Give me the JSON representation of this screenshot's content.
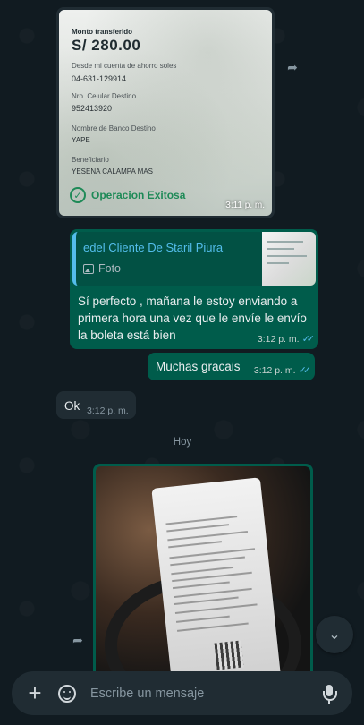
{
  "receipt": {
    "title": "Monto transferido",
    "amount": "S/ 280.00",
    "from_label": "Desde mi cuenta de ahorro soles",
    "from_value": "04-631-129914",
    "phone_label": "Nro. Celular Destino",
    "phone_value": "952413920",
    "bank_label": "Nombre de Banco Destino",
    "bank_value": "YAPE",
    "beneficiary_label": "Beneficiario",
    "beneficiary_value": "YESENA CALAMPA MAS",
    "status": "Operacion Exitosa",
    "time": "3:11 p. m."
  },
  "messages": {
    "reply": {
      "quoted_author": "edel Cliente De Staril Piura",
      "quoted_type": "Foto",
      "text": "Sí perfecto , mañana le estoy enviando a primera hora  una vez que le envíe  le envío la boleta está bien",
      "time": "3:12 p. m."
    },
    "gracias": {
      "text": "Muchas gracais",
      "time": "3:12 p. m."
    },
    "incoming": {
      "text": "Ok",
      "time": "3:12 p. m."
    },
    "date_divider": "Hoy"
  },
  "icons": {
    "forward": "forward-icon",
    "photo": "photo-icon",
    "check": "check-circle-icon",
    "double_check": "double-check-icon",
    "scroll": "chevron-down-icon",
    "attach": "plus-icon",
    "sticker": "sticker-icon",
    "mic": "mic-icon"
  },
  "composer": {
    "placeholder": "Escribe un mensaje"
  },
  "colors": {
    "outgoing_bubble": "#005c4b",
    "incoming_bubble": "#202c33",
    "read_ticks": "#53bdeb",
    "success_green": "#1e8a57"
  }
}
